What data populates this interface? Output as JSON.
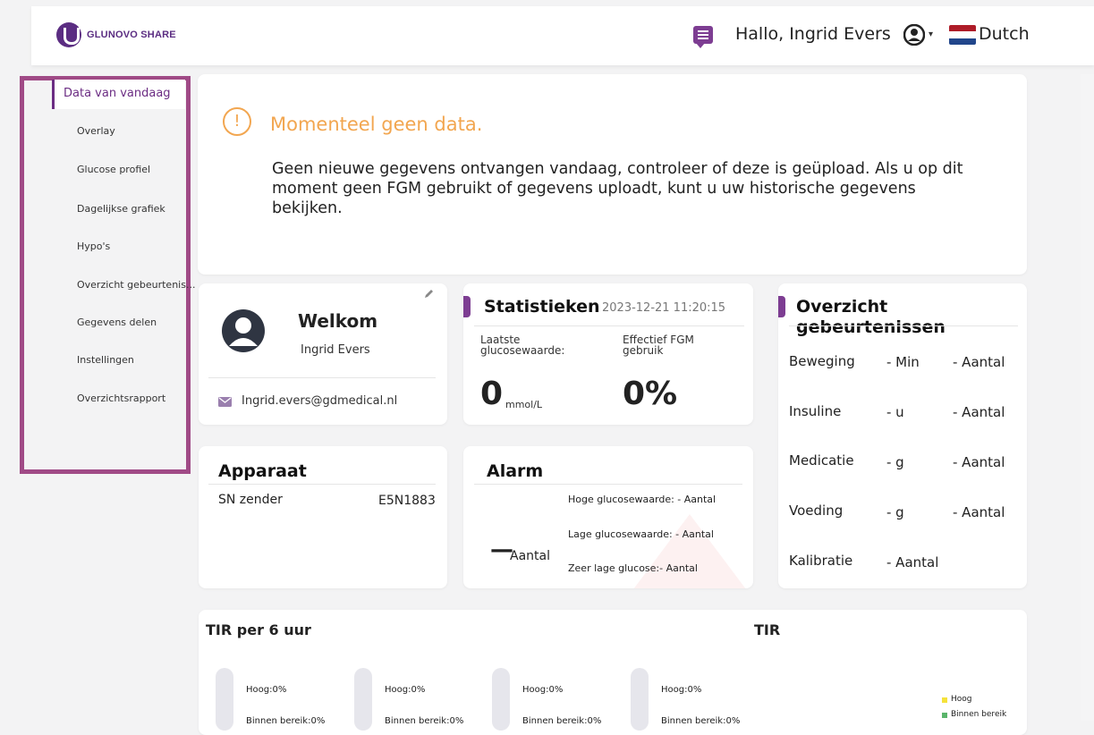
{
  "header": {
    "brand": "GLUNOVO SHARE",
    "greeting": "Hallo, Ingrid Evers",
    "language": "Dutch",
    "colors": {
      "brand": "#5b2d82",
      "accent": "#7d3d92"
    }
  },
  "sidebar": {
    "items": [
      {
        "label": "Data van vandaag",
        "active": true
      },
      {
        "label": "Overlay"
      },
      {
        "label": "Glucose profiel"
      },
      {
        "label": "Dagelijkse grafiek"
      },
      {
        "label": "Hypo's"
      },
      {
        "label": "Overzicht gebeurtenis..."
      },
      {
        "label": "Gegevens delen"
      },
      {
        "label": "Instellingen"
      },
      {
        "label": "Overzichtsrapport"
      }
    ]
  },
  "alert": {
    "title": "Momenteel geen data.",
    "text": "Geen nieuwe gegevens ontvangen vandaag, controleer of deze is geüpload. Als u op dit moment geen FGM gebruikt of gegevens uploadt, kunt u uw historische gegevens bekijken."
  },
  "welcome": {
    "title": "Welkom",
    "name": "Ingrid Evers",
    "email": "Ingrid.evers@gdmedical.nl"
  },
  "stats": {
    "title": "Statistieken",
    "timestamp": "2023-12-21 11:20:15",
    "last_label_1": "Laatste",
    "last_label_2": "glucosewaarde:",
    "effective_label_1": "Effectief FGM",
    "effective_label_2": "gebruik",
    "last_value": "0",
    "last_unit": "mmol/L",
    "effective_value": "0%"
  },
  "events": {
    "title_1": "Overzicht",
    "title_2": "gebeurtenissen",
    "rows": [
      {
        "name": "Beweging",
        "v1": "- Min",
        "v2": "- Aantal"
      },
      {
        "name": "Insuline",
        "v1": "- u",
        "v2": "- Aantal"
      },
      {
        "name": "Medicatie",
        "v1": "- g",
        "v2": "- Aantal"
      },
      {
        "name": "Voeding",
        "v1": "- g",
        "v2": "- Aantal"
      },
      {
        "name": "Kalibratie",
        "v1": "- Aantal",
        "v2": ""
      }
    ]
  },
  "device": {
    "title": "Apparaat",
    "label": "SN zender",
    "value": "E5N1883"
  },
  "alarm": {
    "title": "Alarm",
    "count_value": "—",
    "count_label": "Aantal",
    "high": "Hoge glucosewaarde: - Aantal",
    "low": "Lage glucosewaarde: - Aantal",
    "very_low": "Zeer lage glucose:- Aantal"
  },
  "tir": {
    "title_left": "TIR per 6 uur",
    "title_right": "TIR",
    "bars": [
      {
        "high": "Hoog:0%",
        "in_range": "Binnen bereik:0%"
      },
      {
        "high": "Hoog:0%",
        "in_range": "Binnen bereik:0%"
      },
      {
        "high": "Hoog:0%",
        "in_range": "Binnen bereik:0%"
      },
      {
        "high": "Hoog:0%",
        "in_range": "Binnen bereik:0%"
      }
    ],
    "legend": [
      "Hoog",
      "Binnen bereik"
    ],
    "legend_colors": [
      "#f5e23b",
      "#5ab56b"
    ]
  }
}
